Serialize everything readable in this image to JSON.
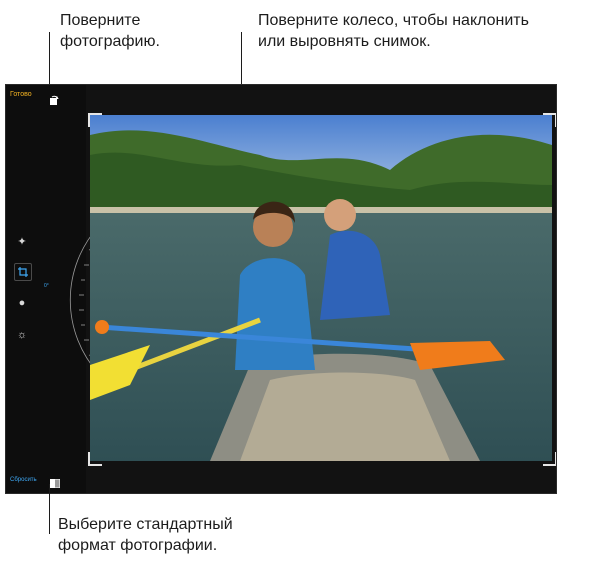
{
  "callouts": {
    "rotate_line1": "Поверните",
    "rotate_line2": "фотографию.",
    "straighten_line1": "Поверните колесо, чтобы наклонить",
    "straighten_line2": "или выровнять снимок.",
    "aspect_line1": "Выберите стандартный",
    "aspect_line2": "формат фотографии."
  },
  "editor": {
    "done_label": "Готово",
    "reset_label": "Сбросить",
    "dial_value": "0°",
    "accent_color": "#f4b322",
    "active_color": "#3fa9f5"
  },
  "icons": {
    "rotate": "rotate-icon",
    "enhance": "magic-wand-icon",
    "crop": "crop-icon",
    "filters": "filters-icon",
    "adjust": "adjust-icon",
    "aspect": "aspect-ratio-icon"
  }
}
